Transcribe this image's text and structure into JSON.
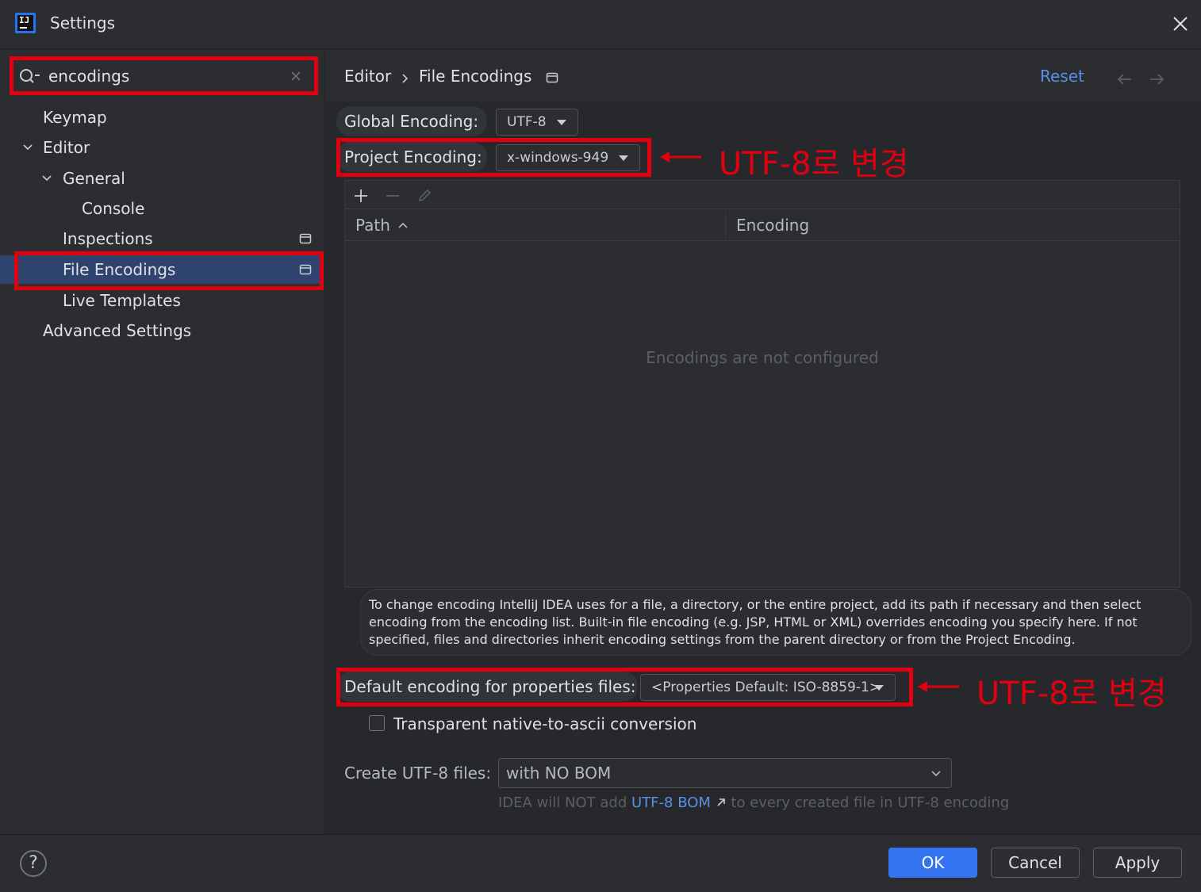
{
  "window": {
    "title": "Settings"
  },
  "search": {
    "value": "encodings"
  },
  "sidebar": {
    "items": [
      {
        "label": "Keymap"
      },
      {
        "label": "Editor"
      },
      {
        "label": "General"
      },
      {
        "label": "Console"
      },
      {
        "label": "Inspections"
      },
      {
        "label": "File Encodings"
      },
      {
        "label": "Live Templates"
      },
      {
        "label": "Advanced Settings"
      }
    ]
  },
  "header": {
    "breadcrumb": [
      "Editor",
      "File Encodings"
    ],
    "reset_label": "Reset"
  },
  "form": {
    "global_label": "Global Encoding:",
    "global_value": "UTF-8",
    "project_label": "Project Encoding:",
    "project_value": "x-windows-949",
    "table": {
      "columns": [
        "Path",
        "Encoding"
      ],
      "empty_text": "Encodings are not configured"
    },
    "note": "To change encoding IntelliJ IDEA uses for a file, a directory, or the entire project, add its path if necessary and then select encoding from the encoding list. Built-in file encoding (e.g. JSP, HTML or XML) overrides encoding you specify here. If not specified, files and directories inherit encoding settings from the parent directory or from the Project Encoding.",
    "properties_label": "Default encoding for properties files:",
    "properties_value": "<Properties Default: ISO-8859-1>",
    "transparent_label": "Transparent native-to-ascii conversion",
    "transparent_checked": false,
    "create_label": "Create UTF-8 files:",
    "create_value": "with NO BOM",
    "hint_prefix": "IDEA will NOT add",
    "hint_link": "UTF-8 BOM",
    "hint_suffix": "to every created file in UTF-8 encoding"
  },
  "annotations": {
    "project_note": "UTF-8로 변경",
    "properties_note": "UTF-8로 변경"
  },
  "buttons": {
    "ok": "OK",
    "cancel": "Cancel",
    "apply": "Apply",
    "help": "?"
  },
  "colors": {
    "accent": "#3574f0",
    "link": "#5a8fe8",
    "highlight_red": "#e0000f",
    "selection": "#2e436e",
    "background": "#2b2d30"
  }
}
